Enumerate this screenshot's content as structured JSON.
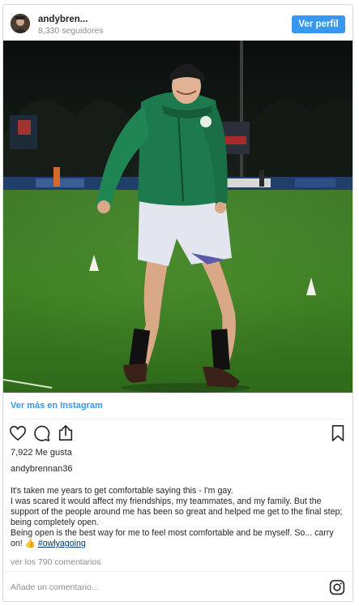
{
  "header": {
    "username": "andybren...",
    "followers": "8,330 seguidores",
    "profile_button": "Ver perfil",
    "avatar_icon": "user-avatar-icon"
  },
  "post": {
    "view_more": "Ver más en Instagram",
    "likes": "7,922 Me gusta",
    "owner": "andybrennan36",
    "caption": {
      "line1": "It's taken me years to get comfortable saying this - I'm gay.",
      "line2": "I was scared it would affect my friendships, my teammates, and my family. But the support of the people around me has been so great and helped me get to the final step; being completely open.",
      "line3": "Being open is the best way for me to feel most comfortable and be myself. So... carry on! 👍",
      "hashtag": "#owlyagoing"
    },
    "comments_link": "ver los 790 comentarios",
    "add_comment_placeholder": "Añade un comentario..."
  },
  "icons": {
    "like": "heart-icon",
    "comment": "comment-icon",
    "share": "share-icon",
    "save": "bookmark-icon",
    "instagram": "instagram-logo-icon"
  },
  "colors": {
    "accent": "#3897f0",
    "hashtag": "#003569",
    "muted": "#8e8e8e",
    "text": "#262626"
  }
}
